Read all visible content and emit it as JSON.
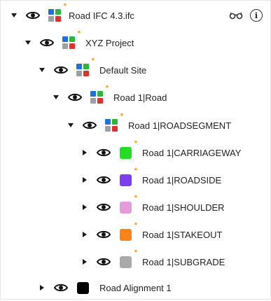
{
  "tree": {
    "root": {
      "label": "Road IFC 4.3.ifc",
      "expanded": true,
      "icon": "ifc-mosaic-icon",
      "modified": true
    },
    "project": {
      "label": "XYZ Project",
      "expanded": true,
      "icon": "ifc-mosaic-icon",
      "modified": true
    },
    "site": {
      "label": "Default Site",
      "expanded": true,
      "icon": "ifc-mosaic-icon",
      "modified": true
    },
    "road": {
      "label": "Road 1|Road",
      "expanded": true,
      "icon": "ifc-mosaic-icon",
      "modified": true
    },
    "segment": {
      "label": "Road 1|ROADSEGMENT",
      "expanded": true,
      "icon": "ifc-mosaic-icon",
      "modified": true
    },
    "layers": [
      {
        "label": "Road 1|CARRIAGEWAY",
        "color": "#22dd22",
        "modified": true
      },
      {
        "label": "Road 1|ROADSIDE",
        "color": "#7b3ff0",
        "modified": true
      },
      {
        "label": "Road 1|SHOULDER",
        "color": "#e79ad9",
        "modified": true
      },
      {
        "label": "Road 1|STAKEOUT",
        "color": "#ff8216",
        "modified": true
      },
      {
        "label": "Road 1|SUBGRADE",
        "color": "#a9a9a9",
        "modified": true
      }
    ],
    "alignment": {
      "label": "Road Alignment 1",
      "color": "#000000",
      "expanded": false
    }
  },
  "modified_marker": "*",
  "header_icons": {
    "glasses": "glasses-icon",
    "info": "info-icon",
    "info_glyph": "i"
  },
  "colors": {
    "star": "#f39a1e",
    "mosaic": [
      "#1e6fe0",
      "#2fb53a",
      "#9aa0a6",
      "#e03030"
    ]
  }
}
